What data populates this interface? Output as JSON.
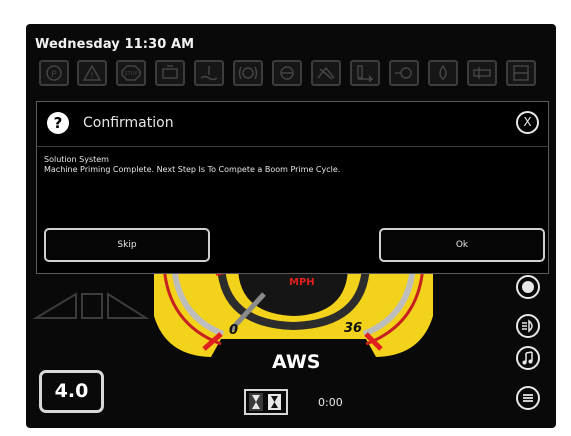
{
  "status_bar": {
    "datetime": "Wednesday 11:30 AM",
    "indicators": [
      {
        "icon": "park-brake-icon",
        "text": "P"
      },
      {
        "icon": "warning-icon",
        "text": "!"
      },
      {
        "icon": "stop-icon",
        "text": "STOP"
      },
      {
        "icon": "engine-icon",
        "text": ""
      },
      {
        "icon": "coolant-icon",
        "text": ""
      },
      {
        "icon": "brake-fault-icon",
        "text": ""
      },
      {
        "icon": "steering-icon",
        "text": ""
      },
      {
        "icon": "drive-fault-icon",
        "text": ""
      },
      {
        "icon": "boom-icon",
        "text": ""
      },
      {
        "icon": "pump-icon",
        "text": ""
      },
      {
        "icon": "fuel-drop-icon",
        "text": ""
      },
      {
        "icon": "filter-icon",
        "text": ""
      },
      {
        "icon": "tank-icon",
        "text": ""
      }
    ]
  },
  "dialog": {
    "title": "Confirmation",
    "close_label": "X",
    "line1": "Solution System",
    "line2": "Machine Priming Complete.  Next Step Is To Compete a Boom Prime Cycle.",
    "skip_label": "Skip",
    "ok_label": "Ok"
  },
  "dashboard": {
    "speed_unit": "MPH",
    "speed_min": "0",
    "speed_max": "36",
    "steer_mode": "AWS",
    "version": "4.0",
    "timer": "0:00",
    "colors": {
      "gauge": "#f2d21a",
      "needle": "#e02020",
      "accent": "#c8c8c8"
    }
  }
}
